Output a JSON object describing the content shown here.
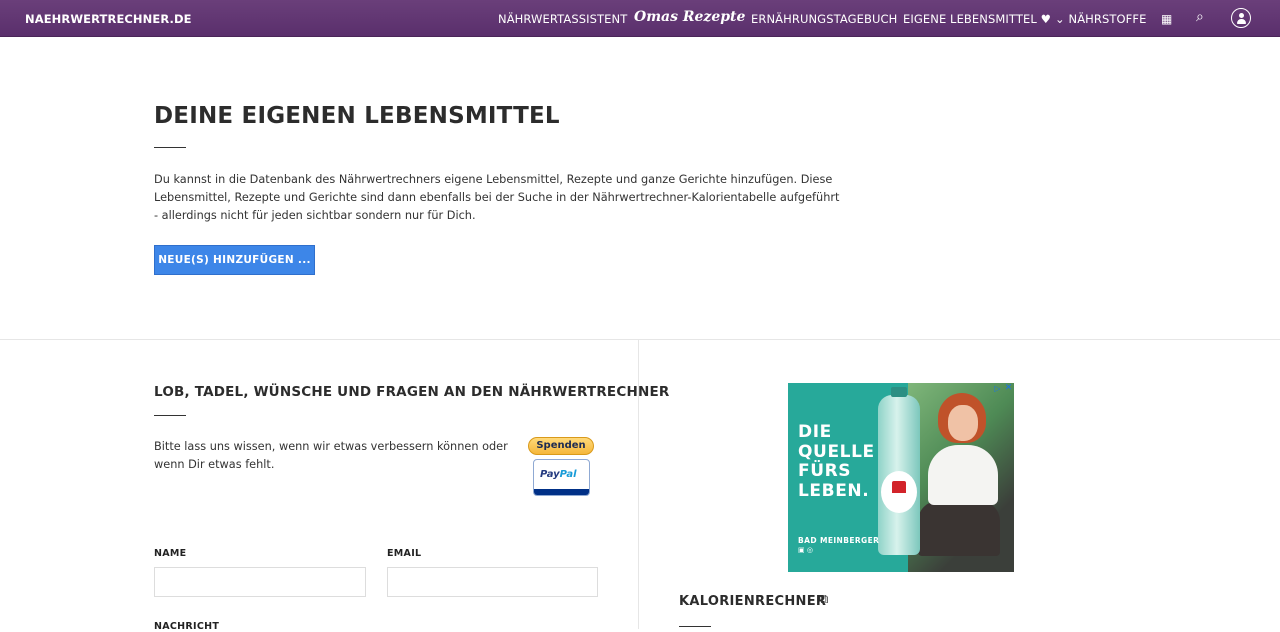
{
  "navbar": {
    "brand": "NAEHRWERTRECHNER.DE",
    "items": [
      {
        "label": "NÄHRWERTASSISTENT"
      },
      {
        "label": "Omas Rezepte"
      },
      {
        "label": "ERNÄHRUNGSTAGEBUCH"
      },
      {
        "label": "EIGENE LEBENSMITTEL ♥"
      },
      {
        "label": "⌄  NÄHRSTOFFE"
      }
    ],
    "icons": {
      "calculator": "▦",
      "search": "⌕"
    }
  },
  "hero": {
    "title": "DEINE EIGENEN LEBENSMITTEL",
    "intro": "Du kannst in die Datenbank des Nährwertrechners eigene Lebensmittel, Rezepte und ganze Gerichte hinzufügen. Diese Lebensmittel, Rezepte und Gerichte sind dann ebenfalls bei der Suche in der Nährwertrechner-Kalorientabelle aufgeführt - allerdings nicht für jeden sichtbar sondern nur für Dich.",
    "add_button": "NEUE(S) HINZUFÜGEN ..."
  },
  "feedback": {
    "title": "LOB, TADEL, WÜNSCHE UND FRAGEN AN DEN NÄHRWERTRECHNER",
    "text": "Bitte lass uns wissen, wenn wir etwas verbessern können oder wenn Dir etwas fehlt.",
    "donate_label": "Spenden",
    "paypal_label_1": "Pay",
    "paypal_label_2": "Pal",
    "name_label": "NAME",
    "email_label": "EMAIL",
    "message_label": "NACHRICHT",
    "name_value": "",
    "email_value": ""
  },
  "ad": {
    "headline": "DIE QUELLE FÜRS LEBEN.",
    "brand": "BAD MEINBERGER",
    "choices_icon": "▷",
    "close_icon": "✕"
  },
  "sidebar": {
    "calorie_title": "KALORIENRECHNER",
    "link_icon": "⧉"
  }
}
